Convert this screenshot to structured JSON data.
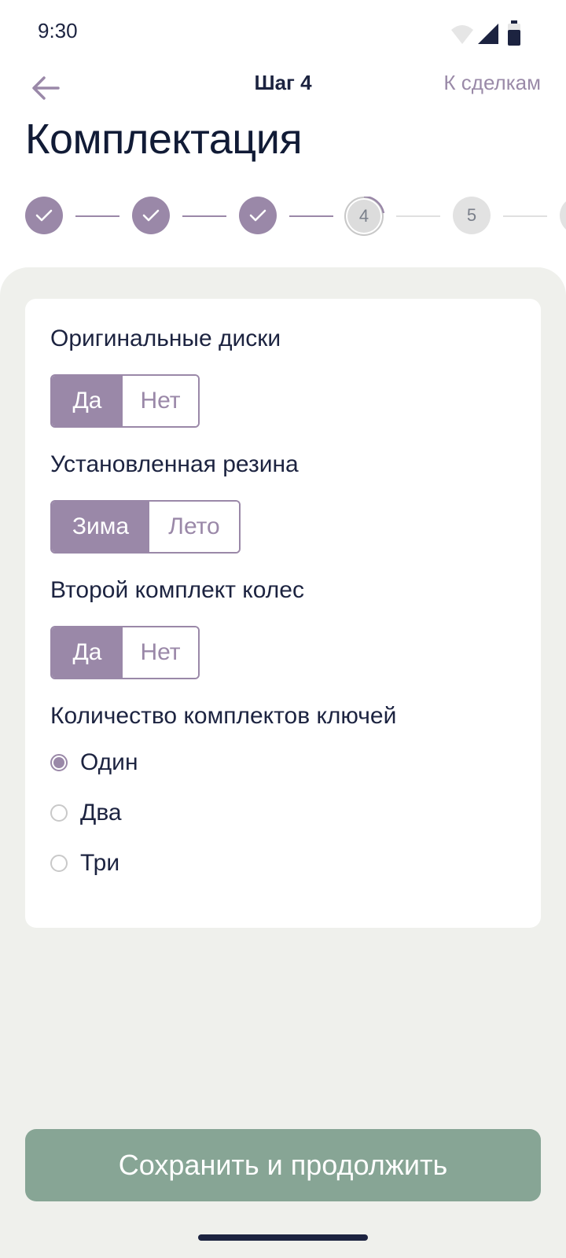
{
  "status_bar": {
    "time": "9:30"
  },
  "header": {
    "step_label": "Шаг 4",
    "deals_link": "К сделкам"
  },
  "page_title": "Комплектация",
  "stepper": {
    "steps": [
      {
        "label": "",
        "state": "done"
      },
      {
        "label": "",
        "state": "done"
      },
      {
        "label": "",
        "state": "done"
      },
      {
        "label": "4",
        "state": "current"
      },
      {
        "label": "5",
        "state": "todo"
      }
    ]
  },
  "form": {
    "original_wheels": {
      "label": "Оригинальные диски",
      "option_yes": "Да",
      "option_no": "Нет",
      "selected": "Да"
    },
    "tires": {
      "label": "Установленная резина",
      "option_winter": "Зима",
      "option_summer": "Лето",
      "selected": "Зима"
    },
    "second_wheel_set": {
      "label": "Второй комплект колес",
      "option_yes": "Да",
      "option_no": "Нет",
      "selected": "Да"
    },
    "key_sets": {
      "label": "Количество комплектов ключей",
      "options": [
        "Один",
        "Два",
        "Три"
      ],
      "selected": "Один"
    }
  },
  "save_button": "Сохранить и продолжить",
  "colors": {
    "accent": "#9a88a8",
    "primary_button": "#87a595",
    "background": "#eff0ec",
    "text": "#1c2340"
  }
}
